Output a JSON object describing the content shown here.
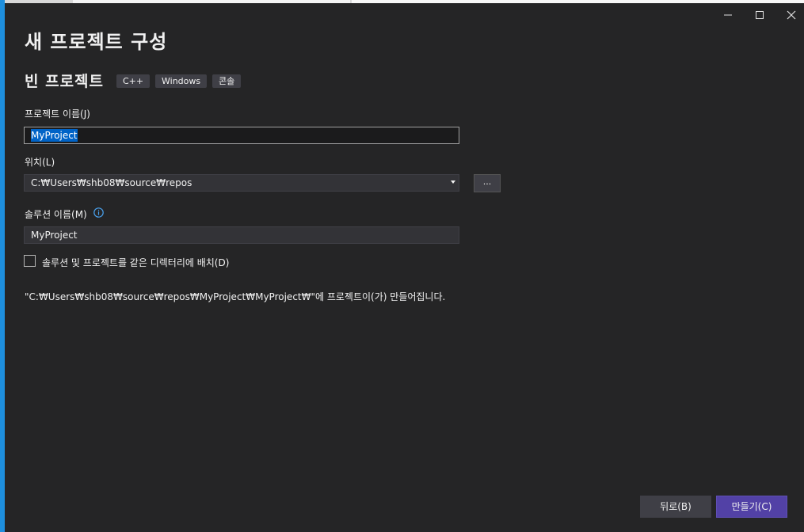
{
  "window": {
    "title": "새 프로젝트 구성",
    "controls": [
      "minimize-icon",
      "maximize-icon",
      "close-icon"
    ]
  },
  "template": {
    "name": "빈 프로젝트",
    "tags": [
      "C++",
      "Windows",
      "콘솔"
    ]
  },
  "form": {
    "project_name_label": "프로젝트 이름(J)",
    "project_name_value": "MyProject",
    "location_label": "위치(L)",
    "location_value": "C:₩Users₩shb08₩source₩repos",
    "browse_label": "...",
    "solution_name_label": "솔루션 이름(M)",
    "solution_name_value": "MyProject",
    "same_dir_label": "솔루션 및 프로젝트를 같은 디렉터리에 배치(D)",
    "same_dir_checked": false,
    "result_note": "\"C:₩Users₩shb08₩source₩repos₩MyProject₩MyProject₩\"에 프로젝트이(가) 만들어집니다."
  },
  "footer": {
    "back_label": "뒤로(B)",
    "create_label": "만들기(C)"
  },
  "colors": {
    "background": "#252526",
    "accent": "#1e8fde",
    "primary_button": "#5241a6",
    "selection": "#0063c7"
  }
}
